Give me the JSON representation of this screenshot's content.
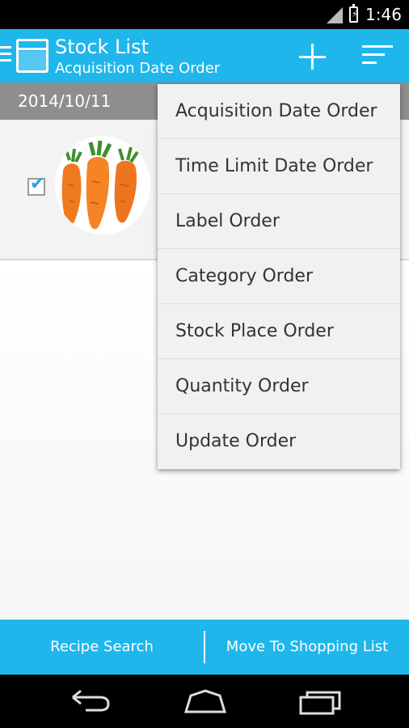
{
  "status_bar": {
    "time": "1:46"
  },
  "action_bar": {
    "title": "Stock List",
    "subtitle": "Acquisition Date Order",
    "add_icon": "plus-icon",
    "sort_icon": "sort-icon"
  },
  "list": {
    "section_date": "2014/10/11",
    "items": [
      {
        "checked": true,
        "image": "carrots"
      }
    ]
  },
  "sort_menu": {
    "items": [
      "Acquisition Date Order",
      "Time Limit Date Order",
      "Label Order",
      "Category Order",
      "Stock Place Order",
      "Quantity Order",
      "Update Order"
    ]
  },
  "bottom_bar": {
    "left_label": "Recipe Search",
    "right_label": "Move To Shopping List"
  },
  "colors": {
    "accent": "#1fb6ec",
    "section_header": "#8e8e8e",
    "checkbox_check": "#23a7e3"
  }
}
